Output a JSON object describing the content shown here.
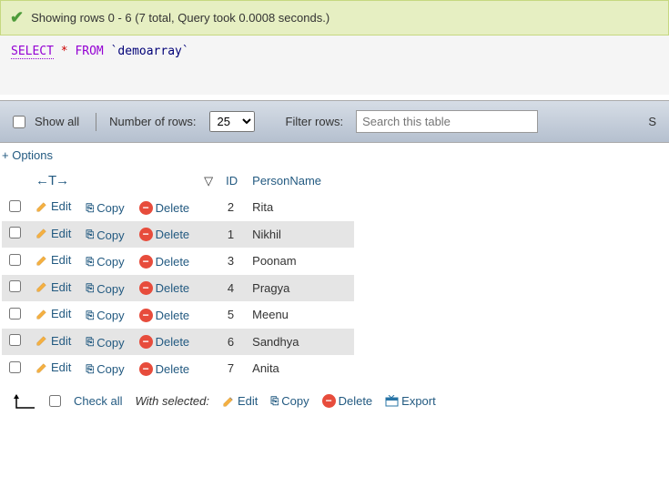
{
  "success": {
    "text": "Showing rows 0 - 6 (7 total, Query took 0.0008 seconds.)"
  },
  "query": {
    "select": "SELECT",
    "star": "*",
    "from": "FROM",
    "table": "`demoarray`"
  },
  "toolbar": {
    "show_all": "Show all",
    "num_rows_label": "Number of rows:",
    "num_rows_value": "25",
    "filter_label": "Filter rows:",
    "filter_placeholder": "Search this table",
    "sort_letter": "S"
  },
  "options_link": "+ Options",
  "columns": {
    "sort_indicator": "←T→",
    "id": "ID",
    "person_name": "PersonName"
  },
  "actions": {
    "edit": "Edit",
    "copy": "Copy",
    "delete": "Delete"
  },
  "rows": [
    {
      "id": "2",
      "name": "Rita"
    },
    {
      "id": "1",
      "name": "Nikhil"
    },
    {
      "id": "3",
      "name": "Poonam"
    },
    {
      "id": "4",
      "name": "Pragya"
    },
    {
      "id": "5",
      "name": "Meenu"
    },
    {
      "id": "6",
      "name": "Sandhya"
    },
    {
      "id": "7",
      "name": "Anita"
    }
  ],
  "bulk": {
    "check_all": "Check all",
    "with_selected": "With selected:",
    "edit": "Edit",
    "copy": "Copy",
    "delete": "Delete",
    "export": "Export"
  }
}
